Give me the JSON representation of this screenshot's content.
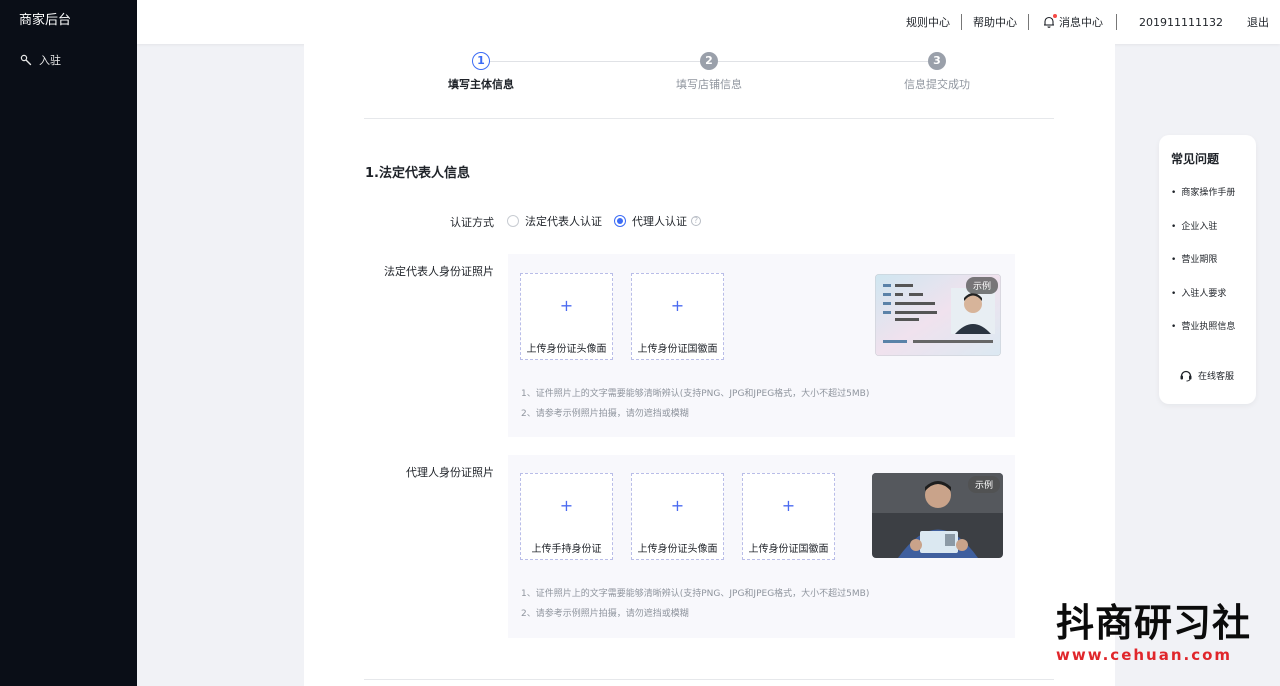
{
  "sidebar": {
    "brand": "商家后台",
    "items": [
      {
        "label": "入驻",
        "icon": "wrench-icon"
      }
    ]
  },
  "topbar": {
    "links": [
      "规则中心",
      "帮助中心"
    ],
    "messages": "消息中心",
    "user_id": "201911111132",
    "logout": "退出"
  },
  "steps": [
    {
      "number": "1",
      "label": "填写主体信息",
      "state": "active"
    },
    {
      "number": "2",
      "label": "填写店铺信息",
      "state": "todo"
    },
    {
      "number": "3",
      "label": "信息提交成功",
      "state": "todo"
    }
  ],
  "section": {
    "title": "1.法定代表人信息"
  },
  "auth": {
    "label": "认证方式",
    "options": [
      {
        "label": "法定代表人认证",
        "checked": false
      },
      {
        "label": "代理人认证",
        "checked": true
      }
    ]
  },
  "legal_photos": {
    "label": "法定代表人身份证照片",
    "uploads": [
      "上传身份证头像面",
      "上传身份证国徽面"
    ],
    "sample_tag": "示例",
    "notes": [
      "1、证件照片上的文字需要能够清晰辨认(支持PNG、JPG和JPEG格式，大小不超过5MB)",
      "2、请参考示例照片拍摄，请勿遮挡或模糊"
    ]
  },
  "agent_photos": {
    "label": "代理人身份证照片",
    "uploads": [
      "上传手持身份证",
      "上传身份证头像面",
      "上传身份证国徽面"
    ],
    "sample_tag": "示例",
    "notes": [
      "1、证件照片上的文字需要能够清晰辨认(支持PNG、JPG和JPEG格式，大小不超过5MB)",
      "2、请参考示例照片拍摄，请勿遮挡或模糊"
    ]
  },
  "faq": {
    "title": "常见问题",
    "items": [
      "商家操作手册",
      "企业入驻",
      "营业期限",
      "入驻人要求",
      "营业执照信息"
    ],
    "service": "在线客服"
  },
  "watermark": {
    "cn": "抖商研习社",
    "url": "www.cehuan.com"
  },
  "colors": {
    "accent": "#3c6cf5",
    "sidebar_bg": "#0a0e17",
    "page_bg": "#f1f2f6"
  }
}
